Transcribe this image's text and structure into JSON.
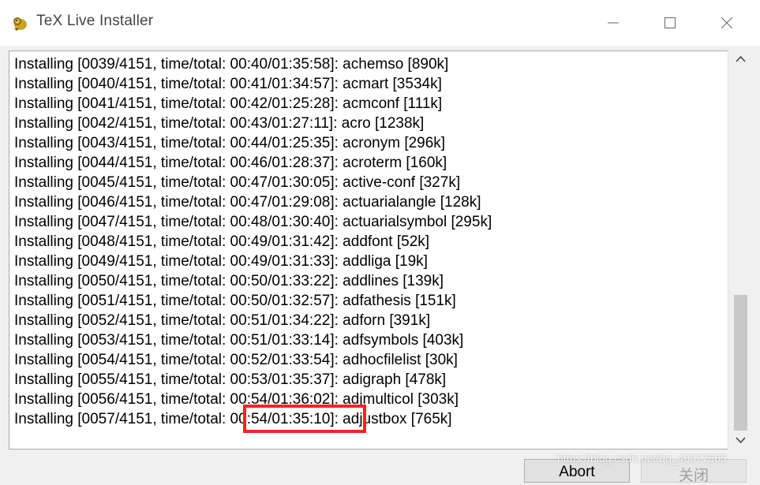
{
  "window": {
    "title": "TeX Live Installer",
    "icon": "tex-live-lion-icon",
    "controls": [
      "minimize-icon",
      "maximize-icon",
      "close-icon"
    ]
  },
  "log": {
    "lines": [
      "Installing [0039/4151, time/total: 00:40/01:35:58]: achemso [890k]",
      "Installing [0040/4151, time/total: 00:41/01:34:57]: acmart [3534k]",
      "Installing [0041/4151, time/total: 00:42/01:25:28]: acmconf [111k]",
      "Installing [0042/4151, time/total: 00:43/01:27:11]: acro [1238k]",
      "Installing [0043/4151, time/total: 00:44/01:25:35]: acronym [296k]",
      "Installing [0044/4151, time/total: 00:46/01:28:37]: acroterm [160k]",
      "Installing [0045/4151, time/total: 00:47/01:30:05]: active-conf [327k]",
      "Installing [0046/4151, time/total: 00:47/01:29:08]: actuarialangle [128k]",
      "Installing [0047/4151, time/total: 00:48/01:30:40]: actuarialsymbol [295k]",
      "Installing [0048/4151, time/total: 00:49/01:31:42]: addfont [52k]",
      "Installing [0049/4151, time/total: 00:49/01:31:33]: addliga [19k]",
      "Installing [0050/4151, time/total: 00:50/01:33:22]: addlines [139k]",
      "Installing [0051/4151, time/total: 00:50/01:32:57]: adfathesis [151k]",
      "Installing [0052/4151, time/total: 00:51/01:34:22]: adforn [391k]",
      "Installing [0053/4151, time/total: 00:51/01:33:14]: adfsymbols [403k]",
      "Installing [0054/4151, time/total: 00:52/01:33:54]: adhocfilelist [30k]",
      "Installing [0055/4151, time/total: 00:53/01:35:37]: adigraph [478k]",
      "Installing [0056/4151, time/total: 00:54/01:36:02]: adjmulticol [303k]",
      "Installing [0057/4151, time/total: 00:54/01:35:10]: adjustbox [765k]"
    ]
  },
  "buttons": {
    "abort": "Abort",
    "close": "关闭"
  },
  "watermark": "https://blog.csdn.net/qq_40077565",
  "colors": {
    "highlight": "#ff2020",
    "scroll_thumb": "#c8c8c8"
  }
}
